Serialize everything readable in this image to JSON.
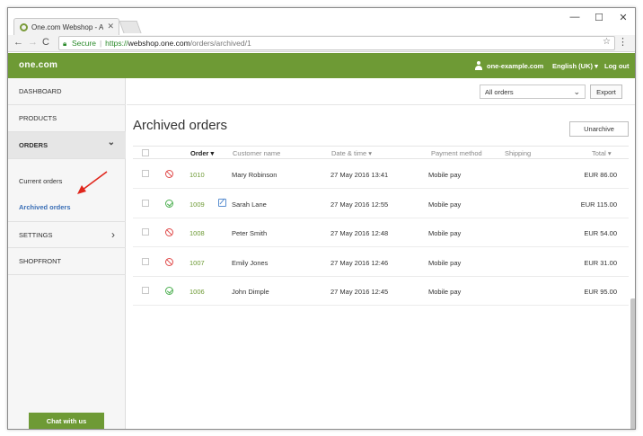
{
  "browser": {
    "tab_title": "One.com Webshop - Arc",
    "tab_close": "✕",
    "minimize": "—",
    "maximize": "☐",
    "close": "✕",
    "back": "←",
    "forward": "→",
    "reload": "C",
    "secure_label": "Secure",
    "url_scheme": "https://",
    "url_host": "webshop.one.com",
    "url_path": "/orders/archived/1",
    "bookmark_star": "☆",
    "menu_dots": "⋮"
  },
  "header": {
    "logo": "one.com",
    "user": "one-example.com",
    "language": "English (UK) ▾",
    "logout": "Log out"
  },
  "sidebar": {
    "items": [
      {
        "label": "DASHBOARD"
      },
      {
        "label": "PRODUCTS"
      },
      {
        "label": "ORDERS",
        "arrow": "⌄"
      },
      {
        "label": "SETTINGS",
        "arrow": "›"
      },
      {
        "label": "SHOPFRONT"
      }
    ],
    "sub_items": [
      {
        "label": "Current orders"
      },
      {
        "label": "Archived orders"
      }
    ],
    "chat_label": "Chat with us"
  },
  "main": {
    "filter_select": "All orders",
    "select_caret": "⌄",
    "export_label": "Export",
    "page_title": "Archived orders",
    "unarchive_label": "Unarchive",
    "columns": {
      "order": "Order ▾",
      "customer": "Customer name",
      "datetime": "Date & time ▾",
      "payment": "Payment method",
      "shipping": "Shipping",
      "total": "Total ▾"
    },
    "rows": [
      {
        "status": "cancelled",
        "id": "1010",
        "note": false,
        "customer": "Mary Robinson",
        "datetime": "27 May 2016 13:41",
        "payment": "Mobile pay",
        "shipping": "",
        "total": "EUR 86.00"
      },
      {
        "status": "completed",
        "id": "1009",
        "note": true,
        "customer": "Sarah Lane",
        "datetime": "27 May 2016 12:55",
        "payment": "Mobile pay",
        "shipping": "",
        "total": "EUR 115.00"
      },
      {
        "status": "cancelled",
        "id": "1008",
        "note": false,
        "customer": "Peter Smith",
        "datetime": "27 May 2016 12:48",
        "payment": "Mobile pay",
        "shipping": "",
        "total": "EUR 54.00"
      },
      {
        "status": "cancelled",
        "id": "1007",
        "note": false,
        "customer": "Emily Jones",
        "datetime": "27 May 2016 12:46",
        "payment": "Mobile pay",
        "shipping": "",
        "total": "EUR 31.00"
      },
      {
        "status": "completed",
        "id": "1006",
        "note": false,
        "customer": "John Dimple",
        "datetime": "27 May 2016 12:45",
        "payment": "Mobile pay",
        "shipping": "",
        "total": "EUR 95.00"
      }
    ]
  },
  "colors": {
    "brand_green": "#6e9a35",
    "link_blue": "#3b6fb6",
    "cancel_red": "#e04b4b",
    "ok_green": "#4caf50",
    "arrow_red": "#e0261c"
  }
}
